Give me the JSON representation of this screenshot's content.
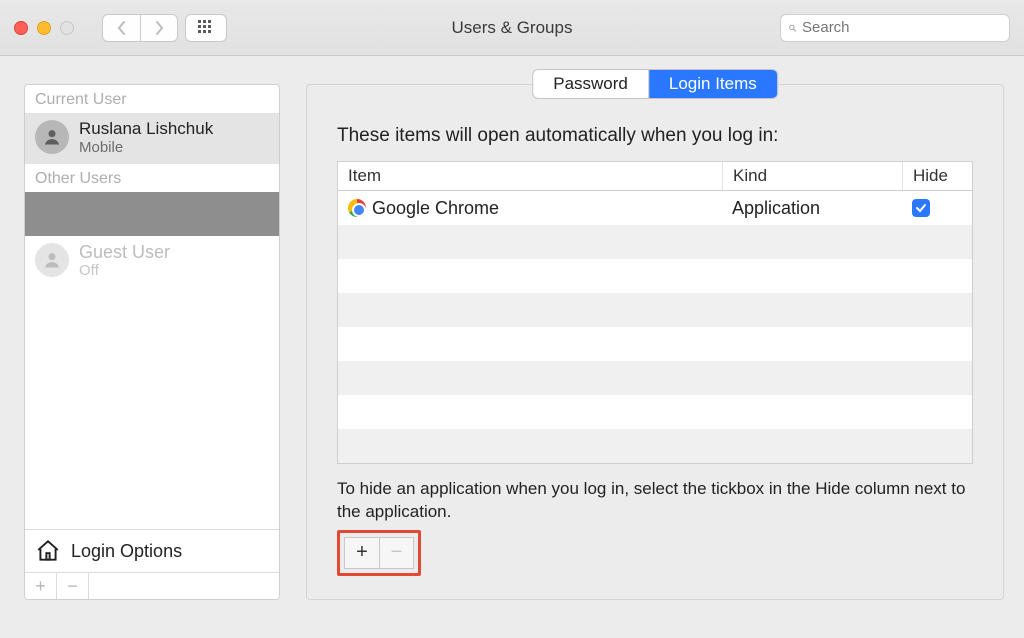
{
  "window": {
    "title": "Users & Groups",
    "search_placeholder": "Search"
  },
  "sidebar": {
    "current_user_header": "Current User",
    "other_users_header": "Other Users",
    "current_user": {
      "name": "Ruslana Lishchuk",
      "role": "Mobile"
    },
    "other_users": [
      {
        "name": "",
        "role": ""
      },
      {
        "name": "Guest User",
        "role": "Off"
      }
    ],
    "login_options_label": "Login Options"
  },
  "tabs": {
    "password": "Password",
    "login_items": "Login Items",
    "active": "login_items"
  },
  "main": {
    "description": "These items will open automatically when you log in:",
    "columns": {
      "item": "Item",
      "kind": "Kind",
      "hide": "Hide"
    },
    "rows": [
      {
        "icon": "chrome",
        "item": "Google Chrome",
        "kind": "Application",
        "hide": true
      }
    ],
    "blank_row_count": 7,
    "hint": "To hide an application when you log in, select the tickbox in the Hide column next to the application."
  }
}
